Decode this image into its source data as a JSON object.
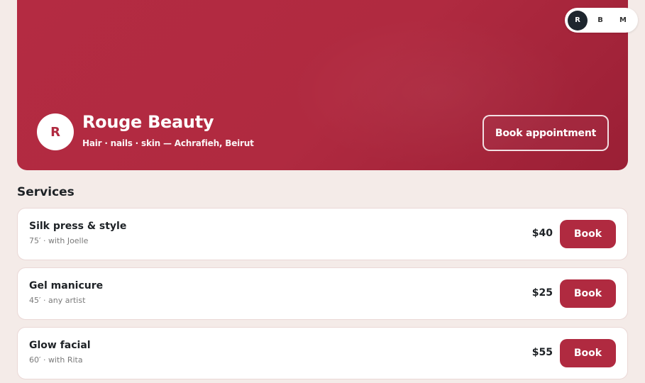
{
  "hero": {
    "avatar_letter": "R",
    "name": "Rouge Beauty",
    "tagline": "Hair · nails · skin — Achrafieh, Beirut",
    "book_label": "Book appointment",
    "accent_color": "#b02a40"
  },
  "switcher": {
    "items": [
      "R",
      "B",
      "M"
    ],
    "active": "R"
  },
  "services": {
    "title": "Services",
    "items": [
      {
        "name": "Silk press & style",
        "meta": "75′ · with Joelle",
        "price": "$40",
        "book": "Book"
      },
      {
        "name": "Gel manicure",
        "meta": "45′ · any artist",
        "price": "$25",
        "book": "Book"
      },
      {
        "name": "Glow facial",
        "meta": "60′ · with Rita",
        "price": "$55",
        "book": "Book"
      }
    ]
  }
}
